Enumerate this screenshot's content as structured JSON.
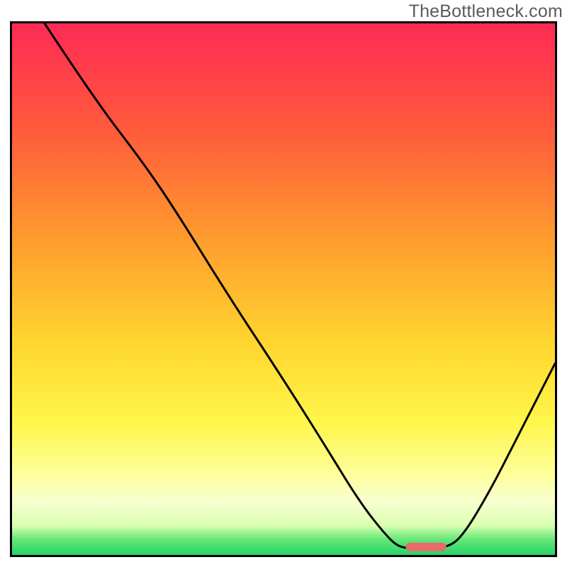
{
  "watermark": "TheBottleneck.com",
  "chart_data": {
    "type": "line",
    "title": "",
    "xlabel": "",
    "ylabel": "",
    "xlim": [
      0,
      100
    ],
    "ylim": [
      0,
      100
    ],
    "background_gradient_stops": [
      {
        "offset": 0.0,
        "color": "#ff2a55"
      },
      {
        "offset": 0.2,
        "color": "#ff5a3c"
      },
      {
        "offset": 0.4,
        "color": "#ff9a2e"
      },
      {
        "offset": 0.6,
        "color": "#ffd52e"
      },
      {
        "offset": 0.75,
        "color": "#fff64a"
      },
      {
        "offset": 0.85,
        "color": "#fdff9c"
      },
      {
        "offset": 0.9,
        "color": "#f8ffd0"
      },
      {
        "offset": 0.945,
        "color": "#d8ffb0"
      },
      {
        "offset": 0.97,
        "color": "#68e878"
      },
      {
        "offset": 1.0,
        "color": "#26d36a"
      }
    ],
    "series": [
      {
        "name": "bottleneck-curve",
        "color": "#000000",
        "stroke_width": 3,
        "points": [
          {
            "x": 6.0,
            "y": 100.0
          },
          {
            "x": 15.0,
            "y": 86.0
          },
          {
            "x": 24.0,
            "y": 74.0
          },
          {
            "x": 30.0,
            "y": 65.0
          },
          {
            "x": 40.0,
            "y": 48.5
          },
          {
            "x": 50.0,
            "y": 33.0
          },
          {
            "x": 58.0,
            "y": 20.0
          },
          {
            "x": 64.0,
            "y": 10.0
          },
          {
            "x": 69.0,
            "y": 3.5
          },
          {
            "x": 71.5,
            "y": 1.3
          },
          {
            "x": 75.0,
            "y": 1.3
          },
          {
            "x": 80.0,
            "y": 1.3
          },
          {
            "x": 83.0,
            "y": 3.5
          },
          {
            "x": 88.0,
            "y": 12.0
          },
          {
            "x": 93.0,
            "y": 22.0
          },
          {
            "x": 100.0,
            "y": 36.0
          }
        ]
      }
    ],
    "marker": {
      "name": "optimal-range",
      "color": "#e86a6a",
      "x_start": 72.5,
      "x_end": 80.0,
      "y": 1.5,
      "thickness": 12,
      "radius": 6
    }
  }
}
